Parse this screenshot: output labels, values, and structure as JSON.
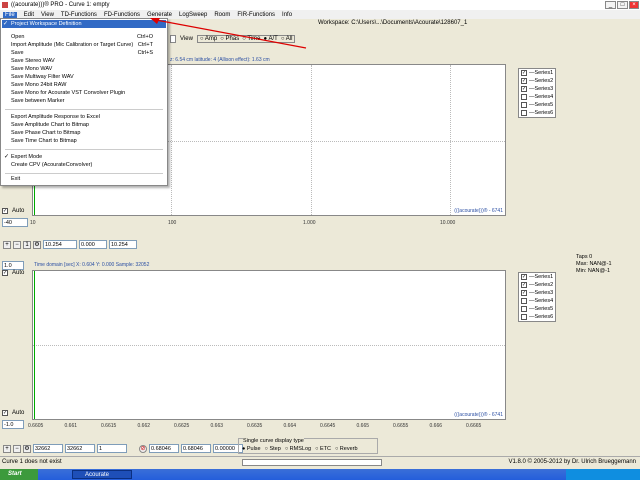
{
  "window": {
    "title": "((acourate)))® PRO - Curve 1: empty"
  },
  "menubar": [
    "File",
    "Edit",
    "View",
    "TD-Functions",
    "FD-Functions",
    "Generate",
    "LogSweep",
    "Room",
    "FIR-Functions",
    "Info"
  ],
  "workspace": "Workspace: C:\\Users\\...\\Documents\\Acourate\\128607_1",
  "view_options": {
    "label": "View",
    "options": [
      "Amp",
      "Phas",
      "Time",
      "A/T",
      "All"
    ],
    "selected": "A/T"
  },
  "info_line": "z: 6.54 cm   latitude: 4 (Allison effect): 1.63 cm",
  "file_menu": {
    "items": [
      {
        "label": "Project Workspace Definition",
        "shortcut": "",
        "highlighted": true
      },
      {
        "label": "Open",
        "shortcut": "Ctrl+O"
      },
      {
        "label": "Import Amplitude (Mic Calibration or Target Curve)",
        "shortcut": "Ctrl+T"
      },
      {
        "label": "Save",
        "shortcut": "Ctrl+S"
      },
      {
        "label": "Save Stereo WAV",
        "shortcut": ""
      },
      {
        "label": "Save Mono WAV",
        "shortcut": ""
      },
      {
        "label": "Save Multiway Filter WAV",
        "shortcut": ""
      },
      {
        "label": "Save Mono 24bit RAW",
        "shortcut": ""
      },
      {
        "label": "Save Mono for Acourate VST Convolver Plugin",
        "shortcut": ""
      },
      {
        "label": "Save between Marker",
        "shortcut": ""
      },
      {
        "label": "Export Amplitude Response to Excel",
        "shortcut": ""
      },
      {
        "label": "Save Amplitude Chart to Bitmap",
        "shortcut": ""
      },
      {
        "label": "Save Phase Chart to Bitmap",
        "shortcut": ""
      },
      {
        "label": "Save Time Chart to Bitmap",
        "shortcut": ""
      },
      {
        "label": "Expert Mode",
        "shortcut": "",
        "checked": true
      },
      {
        "label": "Create CPV (AcourateConvolver)",
        "shortcut": ""
      },
      {
        "label": "Exit",
        "shortcut": ""
      }
    ]
  },
  "top_chart": {
    "x_ticks": [
      "10",
      "100",
      "1.000",
      "10.000"
    ],
    "watermark": "(((acourate)))® - 6741",
    "auto_label": "Auto",
    "y_value": "-40",
    "zoom_fields": [
      "10.254",
      "0.000",
      "10.254"
    ],
    "legend": [
      {
        "label": "Series1",
        "checked": true,
        "color": "#ff0000"
      },
      {
        "label": "Series2",
        "checked": true,
        "color": "#008000"
      },
      {
        "label": "Series3",
        "checked": true,
        "color": "#0000ff"
      },
      {
        "label": "Series4",
        "checked": false,
        "color": "#808000"
      },
      {
        "label": "Series5",
        "checked": false,
        "color": "#800080"
      },
      {
        "label": "Series6",
        "checked": false,
        "color": "#008080"
      }
    ]
  },
  "taps_panel": {
    "taps": "Taps 0",
    "max": "Max: NAN@-1",
    "min": "Min: NAN@-1"
  },
  "bottom_chart": {
    "info": "Time domain [sec]   X: 0.604   Y: 0.000   Sample: 32052",
    "y_top": "1.0",
    "y_bottom": "-1.0",
    "auto_top": "Auto",
    "auto_bottom": "Auto",
    "x_ticks": [
      "0.6605",
      "0.661",
      "0.6615",
      "0.662",
      "0.6625",
      "0.663",
      "0.6635",
      "0.664",
      "0.6645",
      "0.665",
      "0.6655",
      "0.666",
      "0.6665"
    ],
    "watermark": "(((acourate)))® - 6741",
    "zoom_fields": [
      "32662",
      "32662",
      "1"
    ],
    "range_fields": [
      "0.68046",
      "0.68046",
      "0.00000"
    ],
    "legend": [
      {
        "label": "Series1",
        "checked": true
      },
      {
        "label": "Series2",
        "checked": true
      },
      {
        "label": "Series3",
        "checked": true
      },
      {
        "label": "Series4",
        "checked": false
      },
      {
        "label": "Series5",
        "checked": false
      },
      {
        "label": "Series6",
        "checked": false
      }
    ]
  },
  "display_type": {
    "label": "Single curve display type",
    "options": [
      "Pulse",
      "Step",
      "RMSLog",
      "ETC",
      "Reverb"
    ],
    "selected": "Pulse"
  },
  "status": {
    "left": "Curve 1 does not exist",
    "right": "V1.8.0 © 2005-2012 by Dr. Ulrich Brueggemann"
  },
  "taskbar": {
    "start": "Start",
    "app": "Acourate",
    "time": ""
  }
}
